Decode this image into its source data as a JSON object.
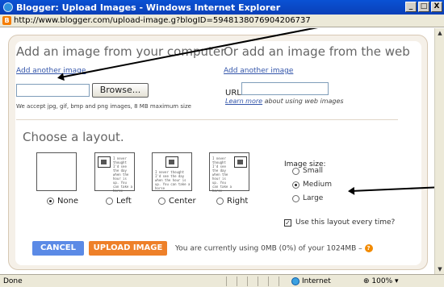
{
  "window": {
    "title": "Blogger: Upload Images - Windows Internet Explorer",
    "url": "http://www.blogger.com/upload-image.g?blogID=5948138076904206737",
    "min": "_",
    "max": "□",
    "close": "X"
  },
  "upload": {
    "computer_heading": "Add an image from your computer",
    "add_another_computer": "Add another image",
    "browse_label": "Browse...",
    "accept_note": "We accept jpg, gif, bmp and png images, 8 MB maximum size",
    "web_heading": "Or add an image from the web",
    "add_another_web": "Add another image",
    "url_label": "URL",
    "url_value": "",
    "learn_more": "Learn more",
    "learn_more_rest": " about using web images"
  },
  "layout": {
    "heading": "Choose a layout.",
    "thumb_text": "I never thought I'd see the day when the hour is up. You can take a horse",
    "options": [
      {
        "label": "None",
        "selected": true
      },
      {
        "label": "Left",
        "selected": false
      },
      {
        "label": "Center",
        "selected": false
      },
      {
        "label": "Right",
        "selected": false
      }
    ]
  },
  "image_size": {
    "title": "Image size:",
    "options": [
      {
        "label": "Small",
        "selected": false
      },
      {
        "label": "Medium",
        "selected": true
      },
      {
        "label": "Large",
        "selected": false
      }
    ],
    "use_layout_label": "Use this layout every time?",
    "use_layout_checked": true
  },
  "actions": {
    "cancel": "CANCEL",
    "upload": "UPLOAD IMAGE",
    "usage": "You are currently using 0MB (0%) of your 1024MB",
    "usage_suffix": " –",
    "help_glyph": "?"
  },
  "status": {
    "left": "Done",
    "zone": "Internet",
    "zoom": "100%"
  },
  "colors": {
    "cancel_bg": "#5b8ae6",
    "upload_bg": "#ee8029",
    "link": "#3355aa"
  }
}
